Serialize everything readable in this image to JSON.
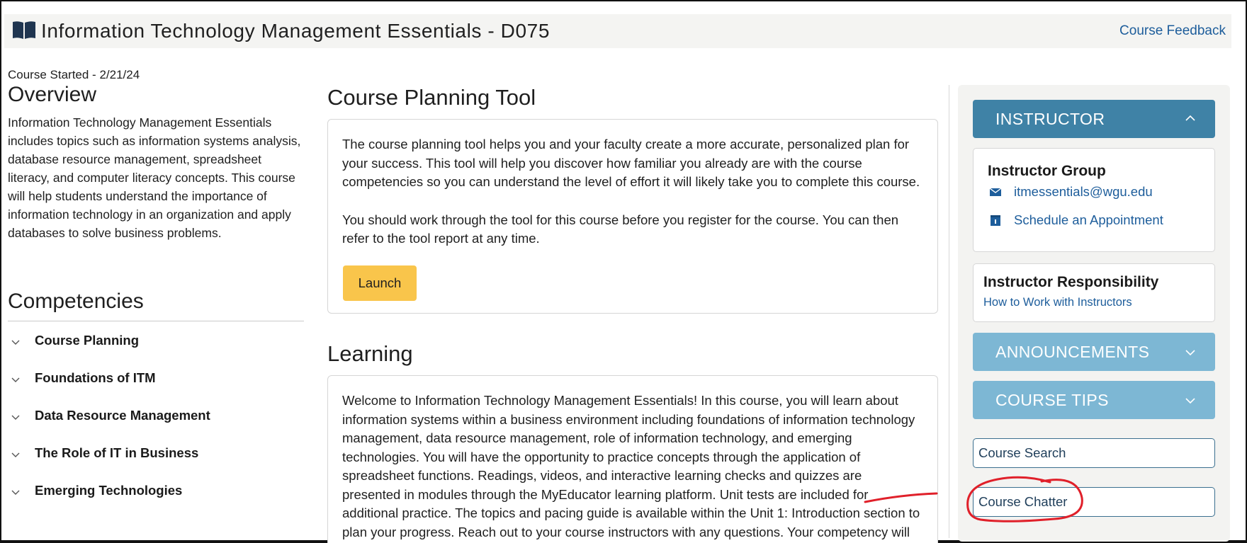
{
  "header": {
    "title": "Information Technology Management Essentials - D075",
    "feedback_link": "Course Feedback"
  },
  "left": {
    "course_started": "Course Started - 2/21/24",
    "overview_heading": "Overview",
    "overview_text": "Information Technology Management Essentials includes topics such as information systems analysis, database resource management, spreadsheet literacy, and computer literacy concepts. This course will help students understand the importance of information technology in an organization and apply databases to solve business problems.",
    "competencies_heading": "Competencies",
    "competencies": [
      {
        "label": "Course Planning"
      },
      {
        "label": "Foundations of ITM"
      },
      {
        "label": "Data Resource Management"
      },
      {
        "label": "The Role of IT in Business"
      },
      {
        "label": "Emerging Technologies"
      }
    ]
  },
  "main": {
    "planning": {
      "heading": "Course Planning Tool",
      "paragraph1": "The course planning tool helps you and your faculty create a more accurate, personalized plan for your success. This tool will help you discover how familiar you already are with the course competencies so you can understand the level of effort it will likely take you to complete this course.",
      "paragraph2": "You should work through the tool for this course before you register for the course. You can then refer to the tool report at any time.",
      "launch_label": "Launch"
    },
    "learning": {
      "heading": "Learning",
      "paragraph": "Welcome to Information Technology Management Essentials! In this course, you will learn about information systems within a business environment including foundations of information technology management, data resource management, role of information technology, and emerging technologies. You will have the opportunity to practice concepts through the application of spreadsheet functions. Readings, videos, and interactive learning checks and quizzes are presented in modules through the MyEducator learning platform. Unit tests are included for additional practice. The topics and pacing guide is available within the Unit 1: Introduction section to plan your progress. Reach out to your course instructors with any questions. Your competency will be"
    }
  },
  "sidebar": {
    "instructor_label": "INSTRUCTOR",
    "instructor_group": {
      "title": "Instructor Group",
      "email": "itmessentials@wgu.edu",
      "appointment": "Schedule an Appointment"
    },
    "responsibility": {
      "title": "Instructor Responsibility",
      "link": "How to Work with Instructors"
    },
    "announcements_label": "ANNOUNCEMENTS",
    "course_tips_label": "COURSE TIPS",
    "course_search_label": "Course Search",
    "course_chatter_label": "Course Chatter"
  },
  "colors": {
    "instructor_header": "#3f82a6",
    "accordion_light": "#7db7d4",
    "link": "#1d5d9b",
    "launch_button": "#f9c54b",
    "annotation": "#e0202a"
  },
  "icons": [
    "book-icon",
    "chevron-down-icon",
    "chevron-up-icon",
    "mail-icon",
    "calendar-icon"
  ]
}
